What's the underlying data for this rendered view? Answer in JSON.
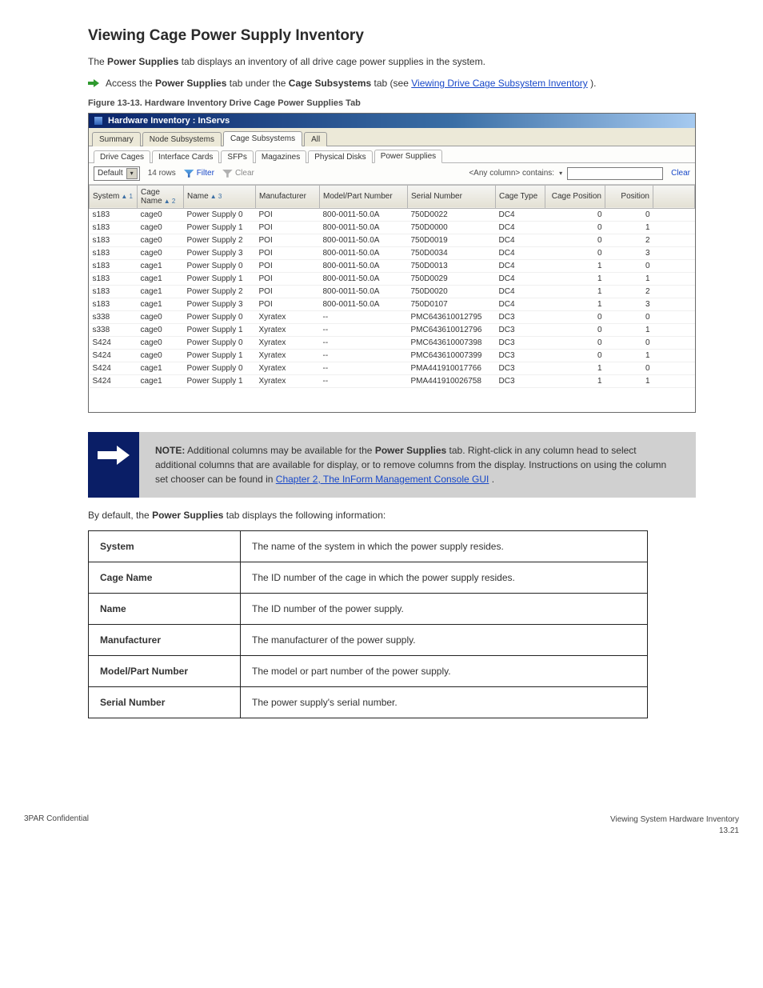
{
  "page": {
    "title": "Viewing Cage Power Supply Inventory",
    "intro_prefix": "The ",
    "intro_tab": "Power Supplies",
    "intro_rest": " tab displays an inventory of all drive cage power supplies in the system.",
    "step_prefix": "Access the ",
    "step_tab": "Power Supplies",
    "step_middle": " tab under the ",
    "step_tab2": "Cage Subsystems",
    "step_suffix": " tab (see ",
    "step_link": "Viewing Drive Cage Subsystem Inventory",
    "step_close": ")."
  },
  "figure": {
    "caption": "Figure 13-13.  Hardware Inventory Drive Cage Power Supplies Tab"
  },
  "app": {
    "title": "Hardware Inventory : InServs",
    "tabs": [
      "Summary",
      "Node Subsystems",
      "Cage Subsystems",
      "All"
    ],
    "tabs_active": 2,
    "subtabs": [
      "Drive Cages",
      "Interface Cards",
      "SFPs",
      "Magazines",
      "Physical Disks",
      "Power Supplies"
    ],
    "subtabs_active": 5,
    "toolbar": {
      "select_value": "Default",
      "rowcount": "14 rows",
      "filter": "Filter",
      "clear": "Clear",
      "anycol_label": "<Any column> contains:",
      "clear_link": "Clear",
      "search_value": ""
    },
    "columns": [
      {
        "label": "System",
        "sort": "▲ 1"
      },
      {
        "label": "Cage Name",
        "sort": "▲ 2"
      },
      {
        "label": "Name",
        "sort": "▲ 3"
      },
      {
        "label": "Manufacturer",
        "sort": ""
      },
      {
        "label": "Model/Part Number",
        "sort": ""
      },
      {
        "label": "Serial Number",
        "sort": ""
      },
      {
        "label": "Cage Type",
        "sort": ""
      },
      {
        "label": "Cage Position",
        "sort": ""
      },
      {
        "label": "Position",
        "sort": ""
      }
    ],
    "rows": [
      {
        "sys": "s183",
        "cage": "cage0",
        "name": "Power Supply 0",
        "mfr": "POI",
        "model": "800-0011-50.0A",
        "serial": "750D0022",
        "type": "DC4",
        "cp": "0",
        "pos": "0"
      },
      {
        "sys": "s183",
        "cage": "cage0",
        "name": "Power Supply 1",
        "mfr": "POI",
        "model": "800-0011-50.0A",
        "serial": "750D0000",
        "type": "DC4",
        "cp": "0",
        "pos": "1"
      },
      {
        "sys": "s183",
        "cage": "cage0",
        "name": "Power Supply 2",
        "mfr": "POI",
        "model": "800-0011-50.0A",
        "serial": "750D0019",
        "type": "DC4",
        "cp": "0",
        "pos": "2"
      },
      {
        "sys": "s183",
        "cage": "cage0",
        "name": "Power Supply 3",
        "mfr": "POI",
        "model": "800-0011-50.0A",
        "serial": "750D0034",
        "type": "DC4",
        "cp": "0",
        "pos": "3"
      },
      {
        "sys": "s183",
        "cage": "cage1",
        "name": "Power Supply 0",
        "mfr": "POI",
        "model": "800-0011-50.0A",
        "serial": "750D0013",
        "type": "DC4",
        "cp": "1",
        "pos": "0"
      },
      {
        "sys": "s183",
        "cage": "cage1",
        "name": "Power Supply 1",
        "mfr": "POI",
        "model": "800-0011-50.0A",
        "serial": "750D0029",
        "type": "DC4",
        "cp": "1",
        "pos": "1"
      },
      {
        "sys": "s183",
        "cage": "cage1",
        "name": "Power Supply 2",
        "mfr": "POI",
        "model": "800-0011-50.0A",
        "serial": "750D0020",
        "type": "DC4",
        "cp": "1",
        "pos": "2"
      },
      {
        "sys": "s183",
        "cage": "cage1",
        "name": "Power Supply 3",
        "mfr": "POI",
        "model": "800-0011-50.0A",
        "serial": "750D0107",
        "type": "DC4",
        "cp": "1",
        "pos": "3"
      },
      {
        "sys": "s338",
        "cage": "cage0",
        "name": "Power Supply 0",
        "mfr": "Xyratex",
        "model": "--",
        "serial": "PMC643610012795",
        "type": "DC3",
        "cp": "0",
        "pos": "0"
      },
      {
        "sys": "s338",
        "cage": "cage0",
        "name": "Power Supply 1",
        "mfr": "Xyratex",
        "model": "--",
        "serial": "PMC643610012796",
        "type": "DC3",
        "cp": "0",
        "pos": "1"
      },
      {
        "sys": "S424",
        "cage": "cage0",
        "name": "Power Supply 0",
        "mfr": "Xyratex",
        "model": "--",
        "serial": "PMC643610007398",
        "type": "DC3",
        "cp": "0",
        "pos": "0"
      },
      {
        "sys": "S424",
        "cage": "cage0",
        "name": "Power Supply 1",
        "mfr": "Xyratex",
        "model": "--",
        "serial": "PMC643610007399",
        "type": "DC3",
        "cp": "0",
        "pos": "1"
      },
      {
        "sys": "S424",
        "cage": "cage1",
        "name": "Power Supply 0",
        "mfr": "Xyratex",
        "model": "--",
        "serial": "PMA441910017766",
        "type": "DC3",
        "cp": "1",
        "pos": "0"
      },
      {
        "sys": "S424",
        "cage": "cage1",
        "name": "Power Supply 1",
        "mfr": "Xyratex",
        "model": "--",
        "serial": "PMA441910026758",
        "type": "DC3",
        "cp": "1",
        "pos": "1"
      }
    ]
  },
  "note": {
    "lead": "NOTE:",
    "body_prefix": " Additional columns may be available for the ",
    "body_tab": "Power Supplies",
    "body_middle": " tab. Right-click in any column head to select additional columns that are available for display, or to remove columns from the display. Instructions on using the column set chooser can be found in ",
    "body_link": "Chapter 2, The InForm Management Console GUI",
    "body_close": "."
  },
  "desc_lead": {
    "prefix": "By default, the ",
    "tab": "Power Supplies",
    "suffix": " tab displays the following information:"
  },
  "defs": [
    {
      "term": "System",
      "desc": "The name of the system in which the power supply resides."
    },
    {
      "term": "Cage Name",
      "desc": "The ID number of the cage in which the power supply resides."
    },
    {
      "term": "Name",
      "desc": "The ID number of the power supply."
    },
    {
      "term": "Manufacturer",
      "desc": "The manufacturer of the power supply."
    },
    {
      "term": "Model/Part Number",
      "desc": "The model or part number of the power supply."
    },
    {
      "term": "Serial Number",
      "desc": "The power supply's serial number."
    }
  ],
  "footer": {
    "left": "3PAR Confidential",
    "right_top": "Viewing System Hardware Inventory",
    "right_bottom": "13.21"
  }
}
